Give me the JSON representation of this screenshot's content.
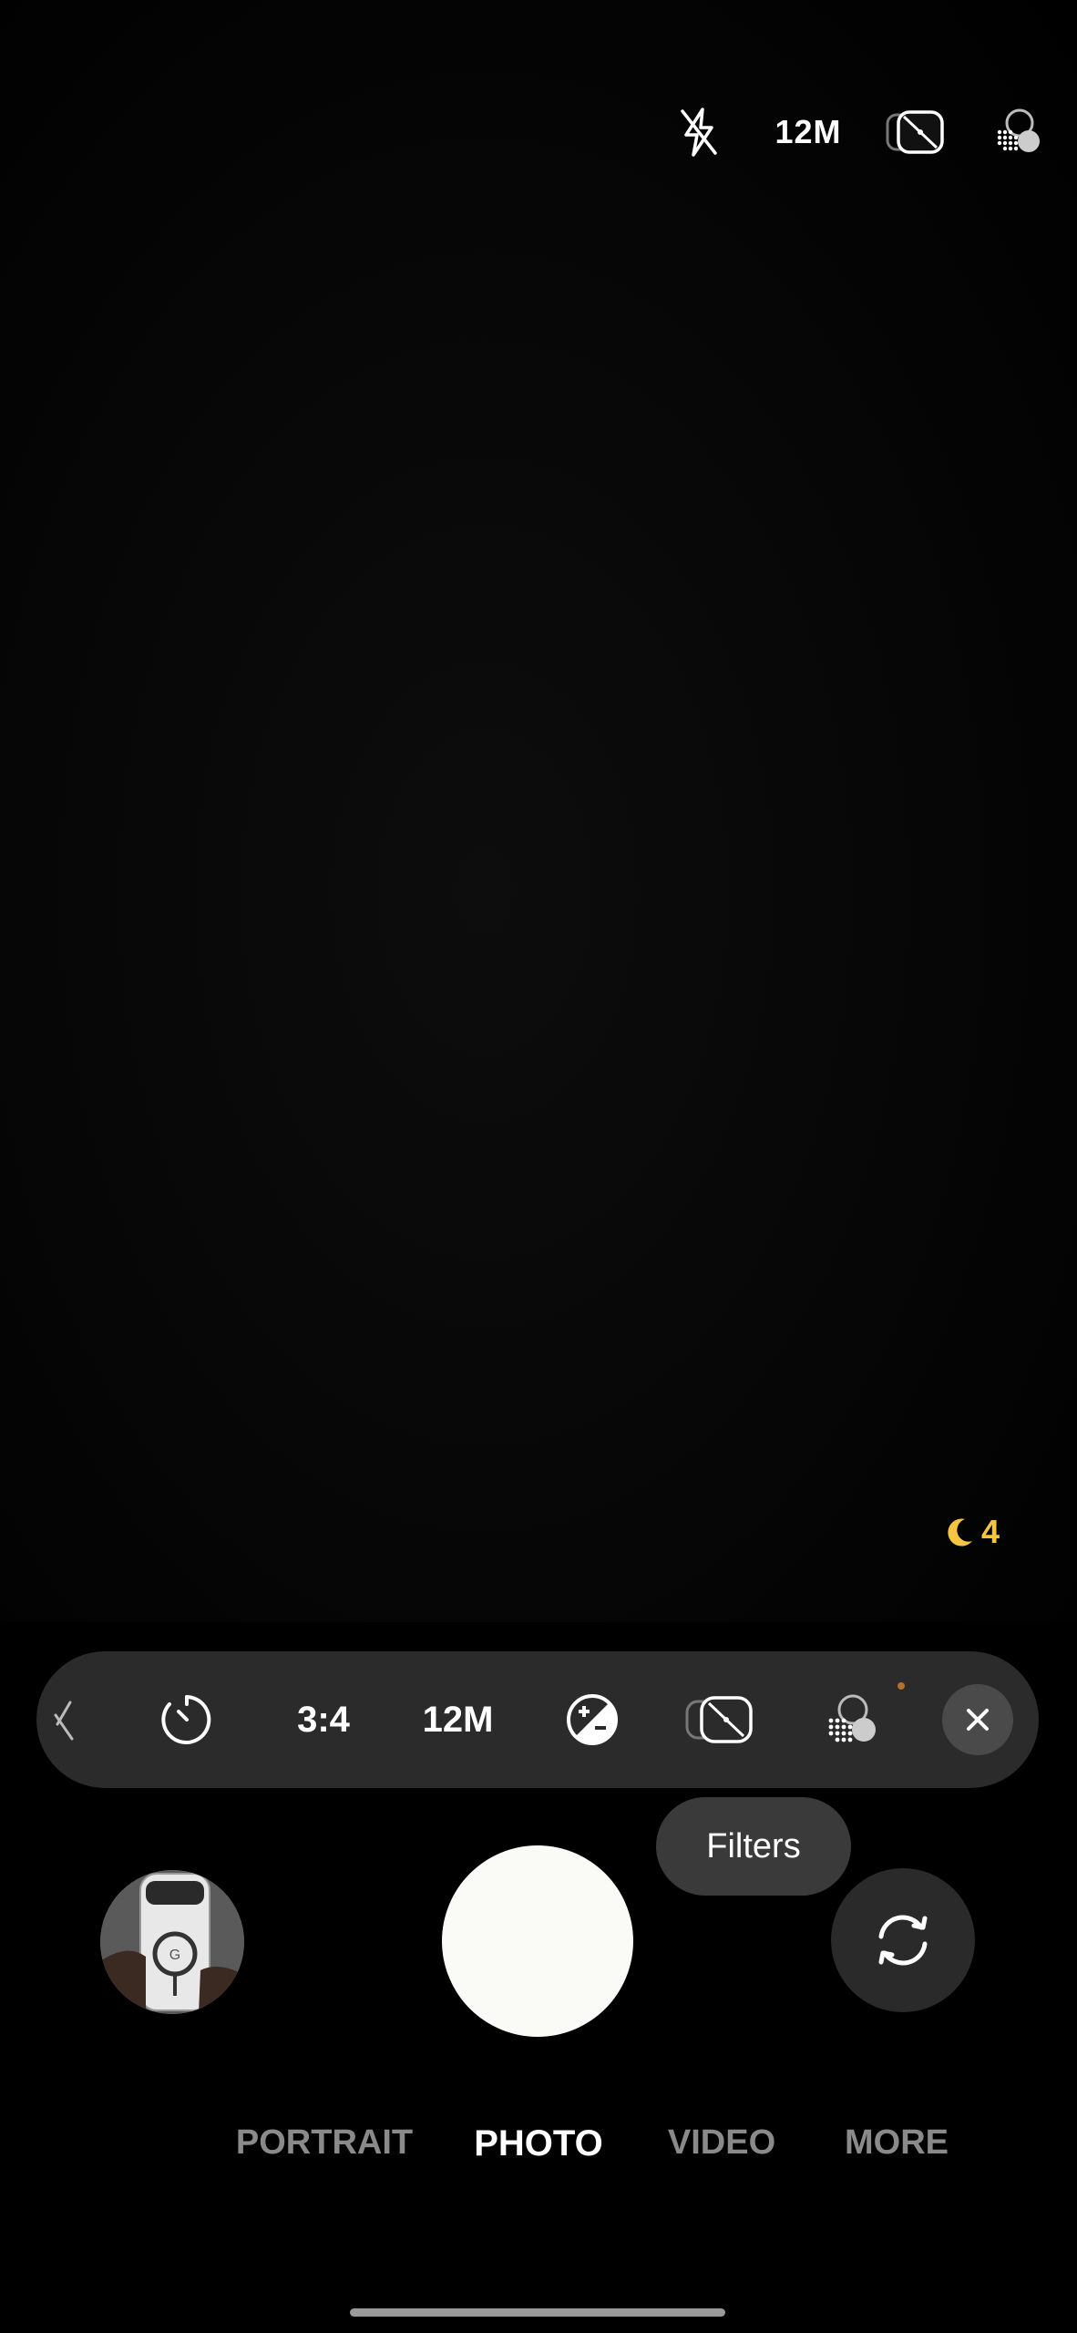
{
  "top_bar": {
    "flash_icon": "flash-off-icon",
    "resolution": "12M",
    "motion_icon": "motion-photo-off-icon",
    "filters_icon": "filters-icon"
  },
  "night_mode": {
    "icon": "moon-icon",
    "value": "4"
  },
  "quick_settings": {
    "items": [
      {
        "name": "flash-off-icon"
      },
      {
        "name": "timer-icon"
      },
      {
        "label": "3:4"
      },
      {
        "label": "12M"
      },
      {
        "name": "exposure-icon"
      },
      {
        "name": "motion-photo-off-icon"
      },
      {
        "name": "filters-icon"
      },
      {
        "name": "close-icon"
      }
    ],
    "ratio": "3:4",
    "resolution": "12M"
  },
  "tooltip": {
    "text": "Filters"
  },
  "modes": {
    "portrait": "PORTRAIT",
    "photo": "PHOTO",
    "video": "VIDEO",
    "more": "MORE",
    "active": "PHOTO"
  },
  "colors": {
    "night_accent": "#f5c542",
    "pill_bg": "#2b2b2b",
    "shutter": "#fafaf7"
  }
}
